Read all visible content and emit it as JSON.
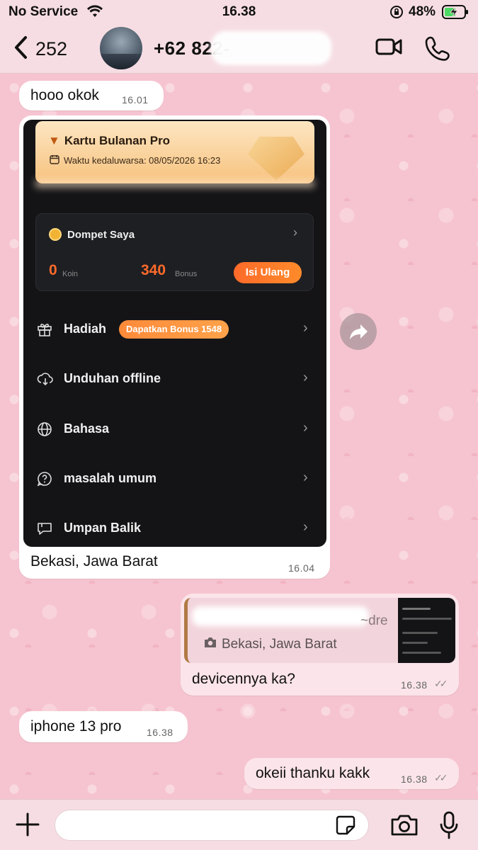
{
  "status_bar": {
    "carrier": "No Service",
    "time": "16.38",
    "battery_percent": "48%"
  },
  "header": {
    "back_count": "252",
    "contact_name": "+62 822-",
    "icons": [
      "chevron-left-icon",
      "video-camera-icon",
      "phone-icon"
    ]
  },
  "messages": [
    {
      "direction": "in",
      "text": "hooo okok",
      "time": "16.01"
    },
    {
      "direction": "in",
      "caption": "Bekasi, Jawa Barat",
      "time": "16.04",
      "screenshot": {
        "pro_title": "Kartu Bulanan Pro",
        "pro_expiry": "Waktu kedaluwarsa: 08/05/2026 16:23",
        "wallet_title": "Dompet Saya",
        "coin_value": "0",
        "coin_label": "Koin",
        "bonus_value": "340",
        "bonus_label": "Bonus",
        "topup_label": "Isi Ulang",
        "menu": [
          {
            "label": "Hadiah",
            "badge": "Dapatkan Bonus 1548",
            "icon": "gift-icon"
          },
          {
            "label": "Unduhan offline",
            "icon": "cloud-download-icon"
          },
          {
            "label": "Bahasa",
            "icon": "globe-icon"
          },
          {
            "label": "masalah umum",
            "icon": "question-icon"
          },
          {
            "label": "Umpan Balik",
            "icon": "feedback-icon"
          }
        ]
      }
    },
    {
      "direction": "out",
      "quote_suffix": "~dre",
      "quote_text": "Bekasi, Jawa Barat",
      "text": "devicennya ka?",
      "time": "16.38",
      "read": true
    },
    {
      "direction": "in",
      "text": "iphone 13 pro",
      "time": "16.38"
    },
    {
      "direction": "out",
      "text": "okeii thanku kakk",
      "time": "16.38",
      "read": true
    }
  ],
  "composer": {
    "placeholder": "",
    "icons": [
      "plus-icon",
      "sticker-icon",
      "camera-icon",
      "microphone-icon"
    ]
  },
  "colors": {
    "wallpaper": "#f6c4d0",
    "incoming_bubble": "#ffffff",
    "outgoing_bubble": "#fbe4ea",
    "accent_orange": "#ff6a2a"
  }
}
